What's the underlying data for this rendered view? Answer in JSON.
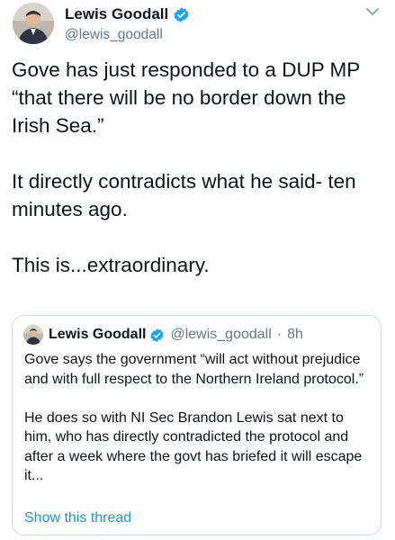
{
  "tweet": {
    "author_name": "Lewis Goodall",
    "author_handle": "@lewis_goodall",
    "paragraphs": [
      "Gove has just responded to a DUP MP “that there will be no border down the Irish Sea.”",
      "It directly contradicts what he said- ten minutes ago.",
      "This is...extraordinary."
    ]
  },
  "quoted_tweet": {
    "author_name": "Lewis Goodall",
    "author_handle": "@lewis_goodall",
    "time_separator": "·",
    "time": "8h",
    "paragraphs": [
      "Gove says the government “will act without prejudice and with full respect to the Northern Ireland protocol.”",
      "He does so with NI Sec Brandon Lewis sat next to him, who has directly contradicted the protocol and after a week where the govt has briefed it will escape it..."
    ],
    "show_thread_label": "Show this thread"
  },
  "icons": {
    "verified": "verified-badge-icon",
    "menu": "chevron-down-icon"
  },
  "colors": {
    "verified_blue": "#1da1f2",
    "link_blue": "#1b95e0",
    "secondary_text": "#657786",
    "border": "#cfd9de"
  }
}
